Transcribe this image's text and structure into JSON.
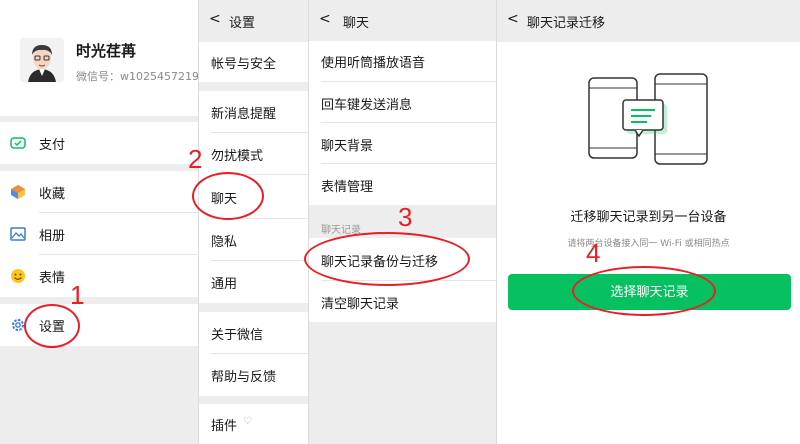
{
  "me": {
    "name": "时光荏苒",
    "wechat_id": "微信号：w1025457219",
    "items": [
      {
        "label": "支付",
        "icon": "payment-icon"
      },
      {
        "label": "收藏",
        "icon": "favorites-icon"
      },
      {
        "label": "相册",
        "icon": "album-icon"
      },
      {
        "label": "表情",
        "icon": "emoji-icon"
      },
      {
        "label": "设置",
        "icon": "settings-icon"
      }
    ]
  },
  "settings": {
    "back": "<",
    "title": "设置",
    "items": [
      "帐号与安全",
      "新消息提醒",
      "勿扰模式",
      "聊天",
      "隐私",
      "通用",
      "关于微信",
      "帮助与反馈",
      "插件"
    ],
    "plugin_badge": "♡"
  },
  "chat": {
    "back": "<",
    "title": "聊天",
    "items": [
      "使用听筒播放语音",
      "回车键发送消息",
      "聊天背景",
      "表情管理"
    ],
    "section_label": "聊天记录",
    "section_items": [
      "聊天记录备份与迁移",
      "清空聊天记录"
    ]
  },
  "migrate": {
    "back": "<",
    "title": "聊天记录迁移",
    "main_title": "迁移聊天记录到另一台设备",
    "subtitle": "请将两台设备接入同一 Wi-Fi 或相同热点",
    "button": "选择聊天记录"
  },
  "annotations": [
    "1",
    "2",
    "3",
    "4"
  ],
  "colors": {
    "accent_green": "#07c160",
    "annotation_red": "#e81f27",
    "background": "#ededed"
  }
}
